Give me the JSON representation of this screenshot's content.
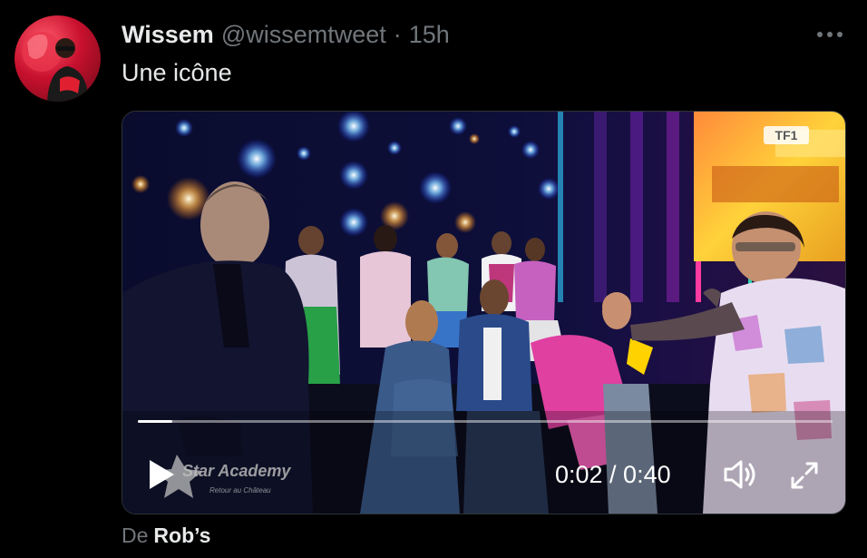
{
  "tweet": {
    "author": {
      "display_name": "Wissem",
      "handle": "@wissemtweet"
    },
    "separator": "·",
    "time": "15h",
    "text": "Une icône",
    "more_icon": "more-horizontal-icon"
  },
  "video": {
    "channel_logo": "TF1",
    "show_logo_title": "Star Academy",
    "show_logo_subtitle": "Retour au Château",
    "current_time": "0:02",
    "duration": "0:40",
    "time_display": "0:02 / 0:40",
    "progress": 0.05,
    "controls": {
      "play_icon": "play-icon",
      "volume_icon": "volume-icon",
      "fullscreen_icon": "fullscreen-icon"
    }
  },
  "attribution": {
    "prefix": "De",
    "source": "Rob’s"
  },
  "colors": {
    "background": "#000000",
    "text_primary": "#e7e9ea",
    "text_secondary": "#71767b",
    "media_border": "#2f3336"
  }
}
